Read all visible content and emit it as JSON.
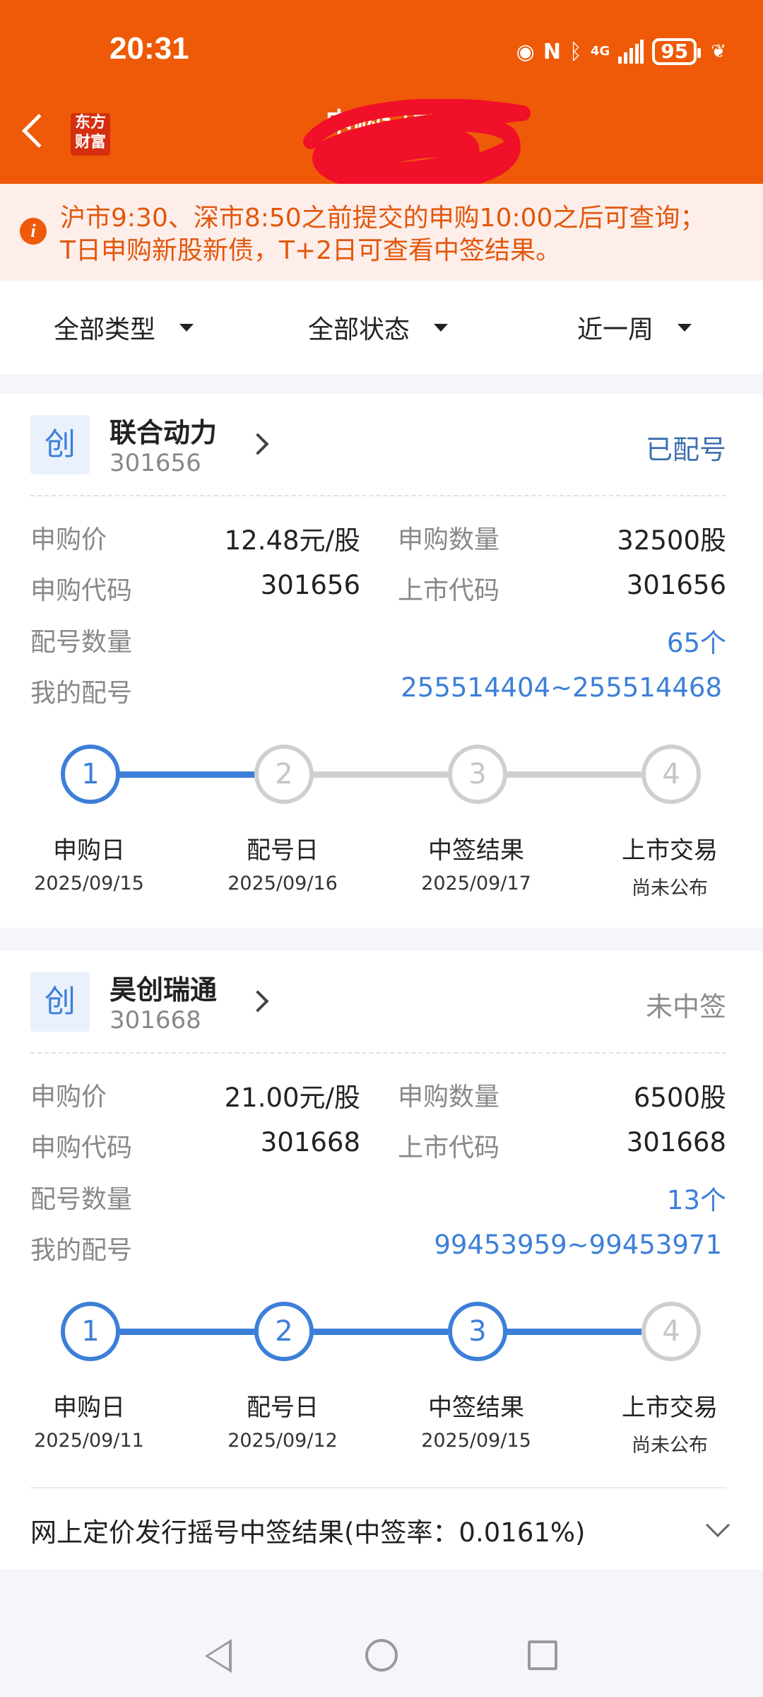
{
  "status_bar": {
    "time": "20:31",
    "network": "4G",
    "battery": "95"
  },
  "header": {
    "brand": "东方财富",
    "title": "申购记录"
  },
  "notice": {
    "text": "沪市9:30、深市8:50之前提交的申购10:00之后可查询；T日申购新股新债，T+2日可查看中签结果。"
  },
  "filters": [
    {
      "label": "全部类型"
    },
    {
      "label": "全部状态"
    },
    {
      "label": "近一周"
    }
  ],
  "labels": {
    "price": "申购价",
    "quantity": "申购数量",
    "sub_code": "申购代码",
    "list_code": "上市代码",
    "num_count": "配号数量",
    "my_numbers": "我的配号"
  },
  "cards": [
    {
      "tag": "创",
      "name": "联合动力",
      "code": "301656",
      "status": "已配号",
      "status_color": "#3d6fb0",
      "price": "12.48元/股",
      "quantity": "32500股",
      "sub_code": "301656",
      "list_code": "301656",
      "num_count": "65个",
      "my_numbers": "255514404~255514468",
      "steps": [
        {
          "num": "1",
          "label": "申购日",
          "date": "2025/09/15"
        },
        {
          "num": "2",
          "label": "配号日",
          "date": "2025/09/16"
        },
        {
          "num": "3",
          "label": "中签结果",
          "date": "2025/09/17"
        },
        {
          "num": "4",
          "label": "上市交易",
          "date": "尚未公布"
        }
      ],
      "progress_step": 1
    },
    {
      "tag": "创",
      "name": "昊创瑞通",
      "code": "301668",
      "status": "未中签",
      "status_color": "#8a8a8a",
      "price": "21.00元/股",
      "quantity": "6500股",
      "sub_code": "301668",
      "list_code": "301668",
      "num_count": "13个",
      "my_numbers": "99453959~99453971",
      "steps": [
        {
          "num": "1",
          "label": "申购日",
          "date": "2025/09/11"
        },
        {
          "num": "2",
          "label": "配号日",
          "date": "2025/09/12"
        },
        {
          "num": "3",
          "label": "中签结果",
          "date": "2025/09/15"
        },
        {
          "num": "4",
          "label": "上市交易",
          "date": "尚未公布"
        }
      ],
      "progress_step": 3,
      "result_row": "网上定价发行摇号中签结果(中签率：0.0161%)"
    }
  ],
  "colors": {
    "brand": "#ee5a07",
    "accent": "#3d7fd8",
    "inactive": "#cfcfcf"
  },
  "nav_icons": [
    "back-triangle-icon",
    "home-circle-icon",
    "recent-square-icon"
  ]
}
